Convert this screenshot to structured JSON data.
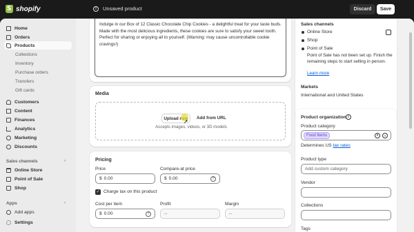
{
  "topbar": {
    "logo_text": "shopify",
    "status_text": "Unsaved product",
    "discard_label": "Discard",
    "save_label": "Save"
  },
  "sidebar": {
    "items": [
      {
        "label": "Home",
        "icon": "home-icon"
      },
      {
        "label": "Orders",
        "icon": "orders-icon"
      },
      {
        "label": "Products",
        "icon": "tag-icon",
        "active": true
      },
      {
        "label": "Customers",
        "icon": "person-icon"
      },
      {
        "label": "Content",
        "icon": "content-icon"
      },
      {
        "label": "Finances",
        "icon": "bank-icon"
      },
      {
        "label": "Analytics",
        "icon": "chart-icon"
      },
      {
        "label": "Marketing",
        "icon": "target-icon"
      },
      {
        "label": "Discounts",
        "icon": "percent-icon"
      }
    ],
    "product_subitems": [
      "Collections",
      "Inventory",
      "Purchase orders",
      "Transfers",
      "Gift cards"
    ],
    "sales_channels_label": "Sales channels",
    "sales_channels": [
      {
        "label": "Online Store",
        "icon": "store-icon"
      },
      {
        "label": "Point of Sale",
        "icon": "pos-icon"
      },
      {
        "label": "Shop",
        "icon": "shop-bag-icon"
      }
    ],
    "apps_label": "Apps",
    "add_apps_label": "Add apps",
    "settings_label": "Settings"
  },
  "description": {
    "text": "Indulge in our Box of 12 Classic Chocolate Chip Cookies - a delightful treat for your taste buds. Made with the most delicious ingredients, these cookies are sure to satisfy your sweet tooth. Perfect for sharing or enjoying all to yourself. (Warning: may cause uncontrollable cookie cravings!)"
  },
  "media": {
    "title": "Media",
    "upload_label": "Upload new",
    "add_url_label": "Add from URL",
    "hint": "Accepts images, videos, or 3D models"
  },
  "pricing": {
    "title": "Pricing",
    "price_label": "Price",
    "price_value": "0.00",
    "compare_label": "Compare-at price",
    "compare_value": "0.00",
    "currency": "$",
    "charge_tax_label": "Charge tax on this product",
    "cost_label": "Cost per item",
    "cost_value": "0.00",
    "profit_label": "Profit",
    "profit_value": "--",
    "margin_label": "Margin",
    "margin_value": "--"
  },
  "publishing": {
    "sales_channels_label": "Sales channels",
    "channels": [
      "Online Store",
      "Shop",
      "Point of Sale"
    ],
    "pos_note": "Point of Sale has not been set up. Finish the remaining steps to start selling in person.",
    "learn_more": "Learn more",
    "markets_label": "Markets",
    "markets_value": "International and United States"
  },
  "organization": {
    "title": "Product organization",
    "category_label": "Product category",
    "category_value": "Food Items",
    "determines_text": "Determines US",
    "tax_rates_link": "tax rates",
    "type_label": "Product type",
    "type_placeholder": "Add custom category",
    "vendor_label": "Vendor",
    "collections_label": "Collections",
    "tags_label": "Tags"
  }
}
